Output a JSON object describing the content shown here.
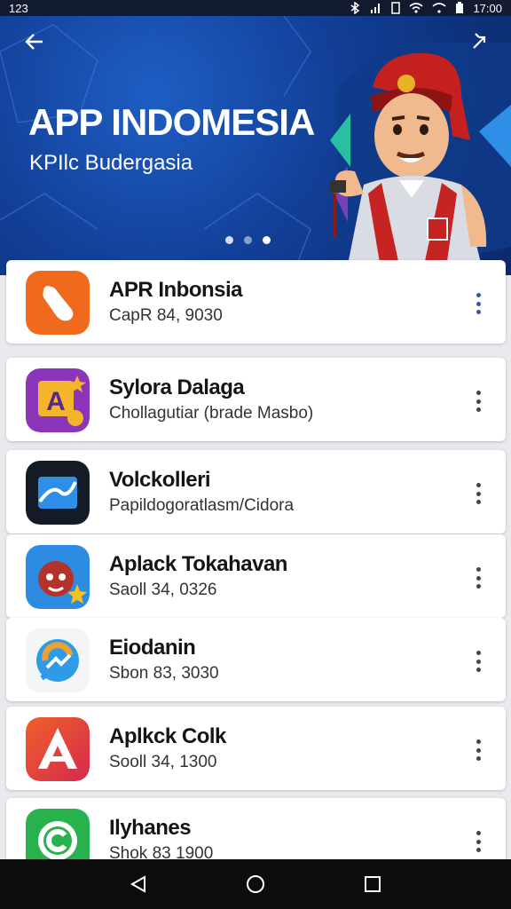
{
  "status_bar": {
    "left": "123",
    "time": "17:00"
  },
  "banner": {
    "title": "APP INDOMESIA",
    "subtitle": "KPIlc Budergasia",
    "dots": 3,
    "active_dot": 3
  },
  "apps": [
    {
      "name": "APR Inbonsia",
      "sub": "CapR 84, 9030",
      "icon": "hand-icon"
    },
    {
      "name": "Sylora Dalaga",
      "sub": "Chollagutiar (brade Masbo)",
      "icon": "letter-a-badge-icon"
    },
    {
      "name": "Volckolleri",
      "sub": "Papildogoratlasm/Cidora",
      "icon": "dashboard-chart-icon"
    },
    {
      "name": "Aplack Tokahavan",
      "sub": "Saoll 34, 0326",
      "icon": "mascot-star-icon"
    },
    {
      "name": "Eiodanin",
      "sub": "Sbon 83, 3030",
      "icon": "messenger-icon"
    },
    {
      "name": "Aplkck Colk",
      "sub": "Sooll 34, 1300",
      "icon": "letter-a-triangle-icon"
    },
    {
      "name": "Ilyhanes",
      "sub": "Shok 83 1900",
      "icon": "whatsapp-c-icon"
    }
  ],
  "colors": {
    "banner": "#123f97",
    "card": "#ffffff",
    "nav_bar": "#0d0d0d"
  }
}
